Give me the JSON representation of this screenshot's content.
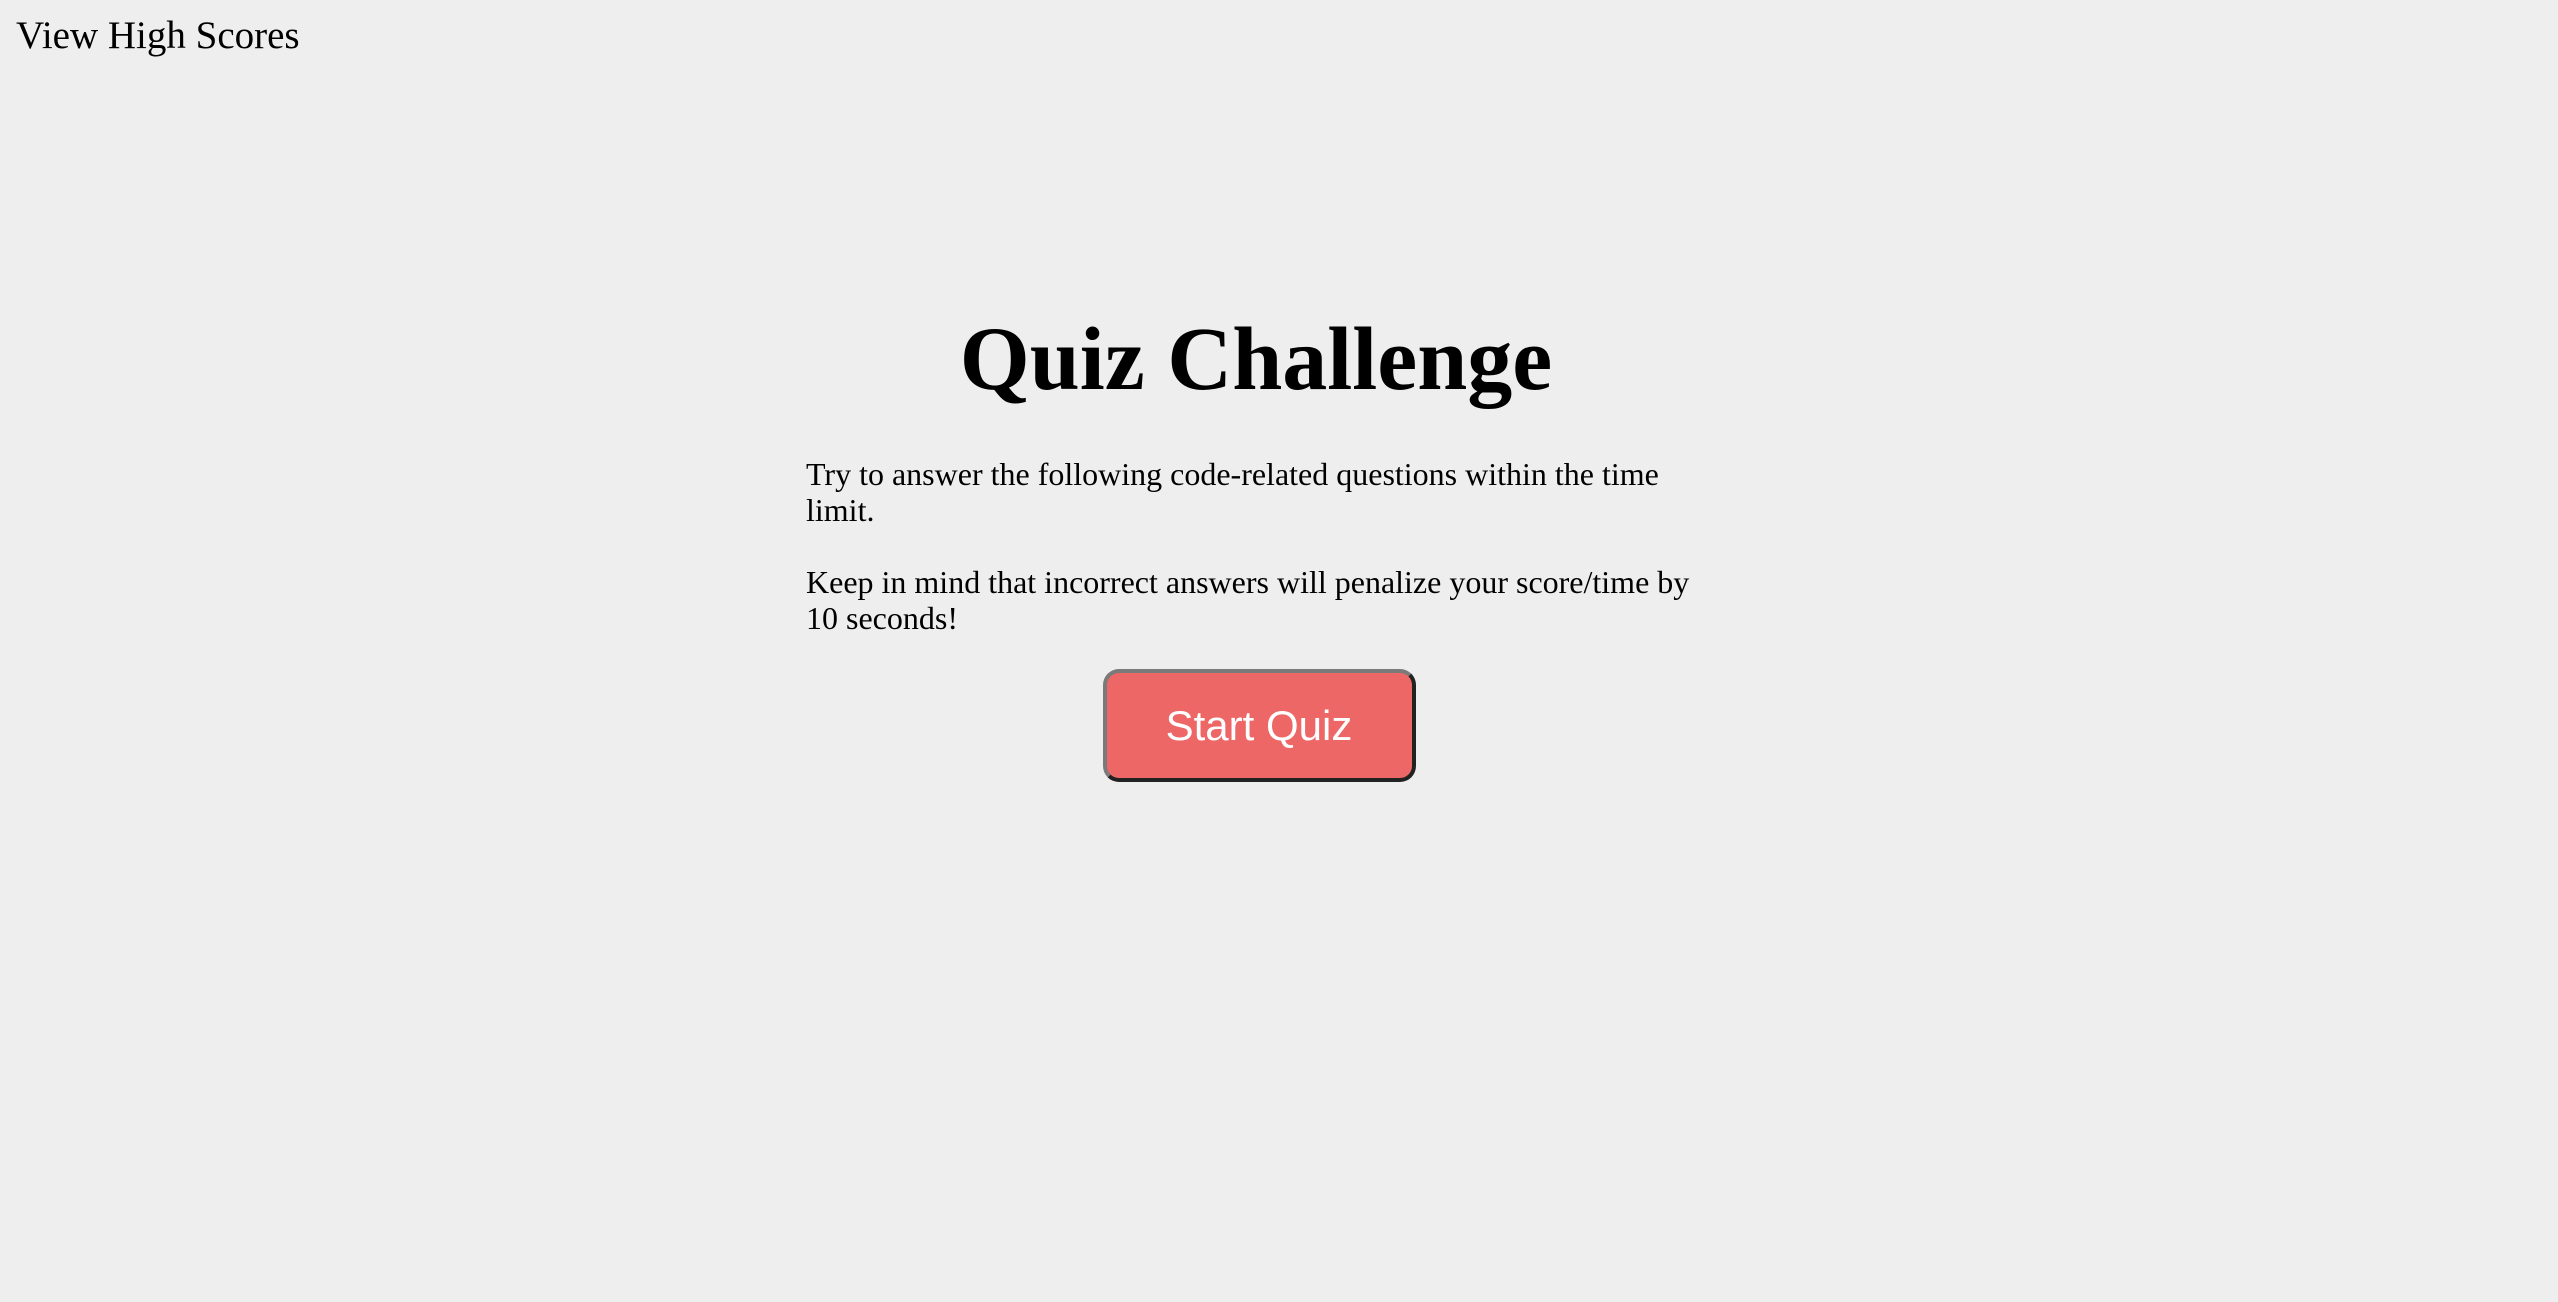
{
  "nav": {
    "high_scores_label": "View High Scores"
  },
  "intro": {
    "title": "Quiz Challenge",
    "paragraph_1": "Try to answer the following code-related questions within the time limit.",
    "paragraph_2": "Keep in mind that incorrect answers will penalize your score/time by 10 seconds!",
    "start_button_label": "Start Quiz"
  },
  "colors": {
    "background": "#eeeeee",
    "start_button": "#ee6767",
    "text": "#000000",
    "button_text": "#ffffff"
  }
}
